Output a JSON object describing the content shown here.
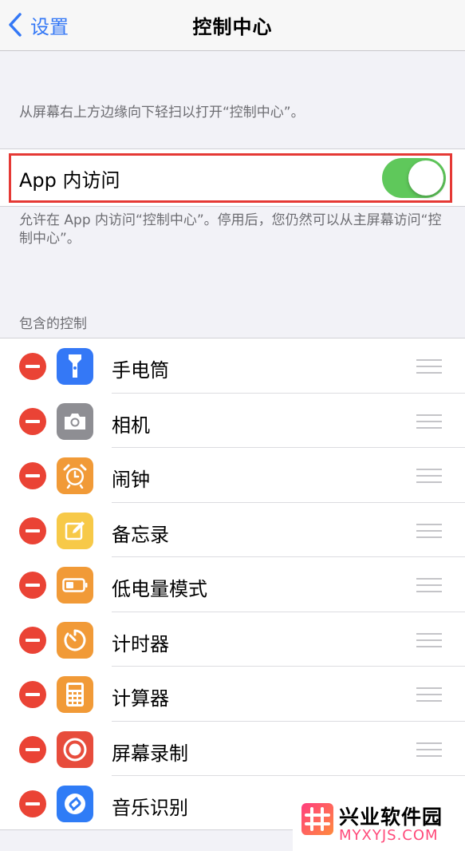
{
  "navbar": {
    "back_label": "设置",
    "title": "控制中心"
  },
  "intro_text": "从屏幕右上方边缘向下轻扫以打开“控制中心”。",
  "access_within_apps": {
    "label": "App 内访问",
    "enabled": true,
    "footnote": "允许在 App 内访问“控制中心”。停用后，您仍然可以从主屏幕访问“控制中心”。"
  },
  "included_controls": {
    "header": "包含的控制",
    "items": [
      {
        "label": "手电筒",
        "icon": "flashlight-icon",
        "color": "#3478f6"
      },
      {
        "label": "相机",
        "icon": "camera-icon",
        "color": "#8e8e93"
      },
      {
        "label": "闹钟",
        "icon": "alarm-clock-icon",
        "color": "#f19a37"
      },
      {
        "label": "备忘录",
        "icon": "notes-icon",
        "color": "#f7c948"
      },
      {
        "label": "低电量模式",
        "icon": "low-power-icon",
        "color": "#f19a37"
      },
      {
        "label": "计时器",
        "icon": "timer-icon",
        "color": "#f19a37"
      },
      {
        "label": "计算器",
        "icon": "calculator-icon",
        "color": "#f19a37"
      },
      {
        "label": "屏幕录制",
        "icon": "screen-record-icon",
        "color": "#e74c3c"
      },
      {
        "label": "音乐识别",
        "icon": "shazam-icon",
        "color": "#2f7cf6"
      }
    ]
  },
  "colors": {
    "accent": "#3478f6",
    "toggle_on": "#5fc85b",
    "remove": "#ea4335",
    "highlight": "#e53935"
  },
  "watermark": {
    "name": "兴业软件园",
    "url": "MYXYJS.COM"
  }
}
